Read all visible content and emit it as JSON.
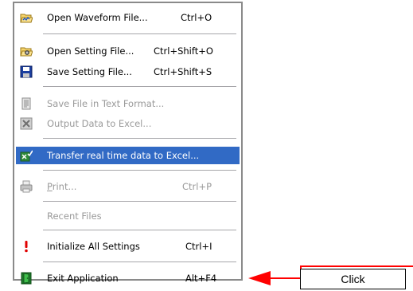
{
  "menu": {
    "open_waveform": {
      "label": "Open Waveform File...",
      "accel": "Ctrl+O",
      "icon": "open-folder-waveform-icon"
    },
    "open_setting": {
      "label": "Open Setting File...",
      "accel": "Ctrl+Shift+O",
      "icon": "open-folder-settings-icon"
    },
    "save_setting": {
      "label": "Save Setting File...",
      "accel": "Ctrl+Shift+S",
      "icon": "floppy-disk-icon"
    },
    "save_text": {
      "label": "Save File in Text Format...",
      "icon": "text-document-icon"
    },
    "output_excel": {
      "label": "Output Data to Excel...",
      "icon": "excel-icon"
    },
    "transfer_excel": {
      "label": "Transfer real time data to Excel...",
      "icon": "excel-transfer-icon"
    },
    "print": {
      "label": "Print...",
      "accel": "Ctrl+P",
      "icon": "printer-icon"
    },
    "recent_files": {
      "label": "Recent Files"
    },
    "initialize": {
      "label": "Initialize All Settings",
      "accel": "Ctrl+I",
      "icon": "exclamation-icon"
    },
    "exit": {
      "label": "Exit Application",
      "accel": "Alt+F4",
      "icon": "exit-door-icon"
    }
  },
  "callout": {
    "label": "Click"
  },
  "colors": {
    "selection": "#316ac5",
    "callout": "#ff0000",
    "disabled_text": "#9a9a9a"
  }
}
